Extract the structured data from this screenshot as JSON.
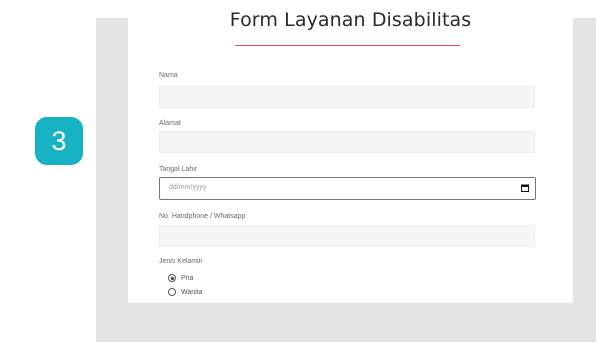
{
  "step": {
    "number": "3",
    "badge_color": "#17b3c4"
  },
  "form": {
    "title": "Form Layanan Disabilitas",
    "title_rule_color": "#d9534a",
    "fields": {
      "name": {
        "label": "Nama",
        "value": ""
      },
      "address": {
        "label": "Alamat",
        "value": ""
      },
      "birth_date": {
        "label": "Tangal Lahir",
        "placeholder": "dd/mm/yyyy",
        "icon": "calendar-icon"
      },
      "phone": {
        "label": "No. Handphone / Whatsapp",
        "value": ""
      },
      "gender": {
        "label": "Jenis Kelamin",
        "options": [
          "Pria",
          "Wanita"
        ],
        "selected": "Pria"
      }
    }
  }
}
